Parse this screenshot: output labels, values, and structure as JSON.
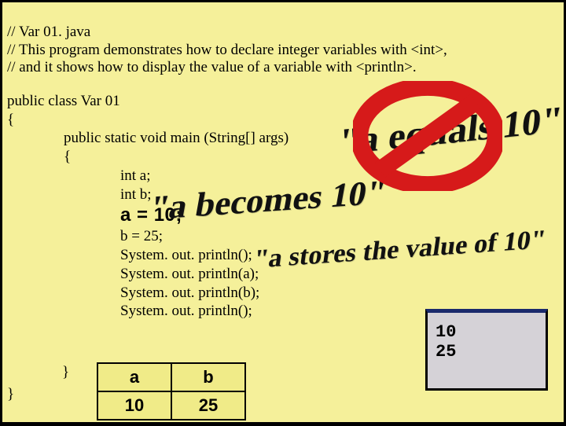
{
  "comments": {
    "line1": "// Var 01. java",
    "line2": "// This program demonstrates how to declare integer variables with <int>,",
    "line3": "// and it shows how to display the value of a variable with <println>."
  },
  "code": {
    "class_decl": "public class Var 01",
    "open_brace": "{",
    "main_decl": "public static void main (String[] args)",
    "main_open": "{",
    "int_a": "int a;",
    "int_b": "int b;",
    "a_assign": "a = 10;",
    "b_assign": "b = 25;",
    "println1": "System. out. println();",
    "println2": "System. out. println(a);",
    "println3": "System. out. println(b);",
    "println4": "System. out. println();",
    "main_close": "}",
    "class_close": "}"
  },
  "wordart": {
    "equals": "\"a equals 10\"",
    "becomes": "\"a becomes 10\"",
    "stores": "\"a stores the value of 10\""
  },
  "memory": {
    "h1": "a",
    "h2": "b",
    "v1": "10",
    "v2": "25"
  },
  "output": {
    "line1": "10",
    "line2": "25"
  }
}
